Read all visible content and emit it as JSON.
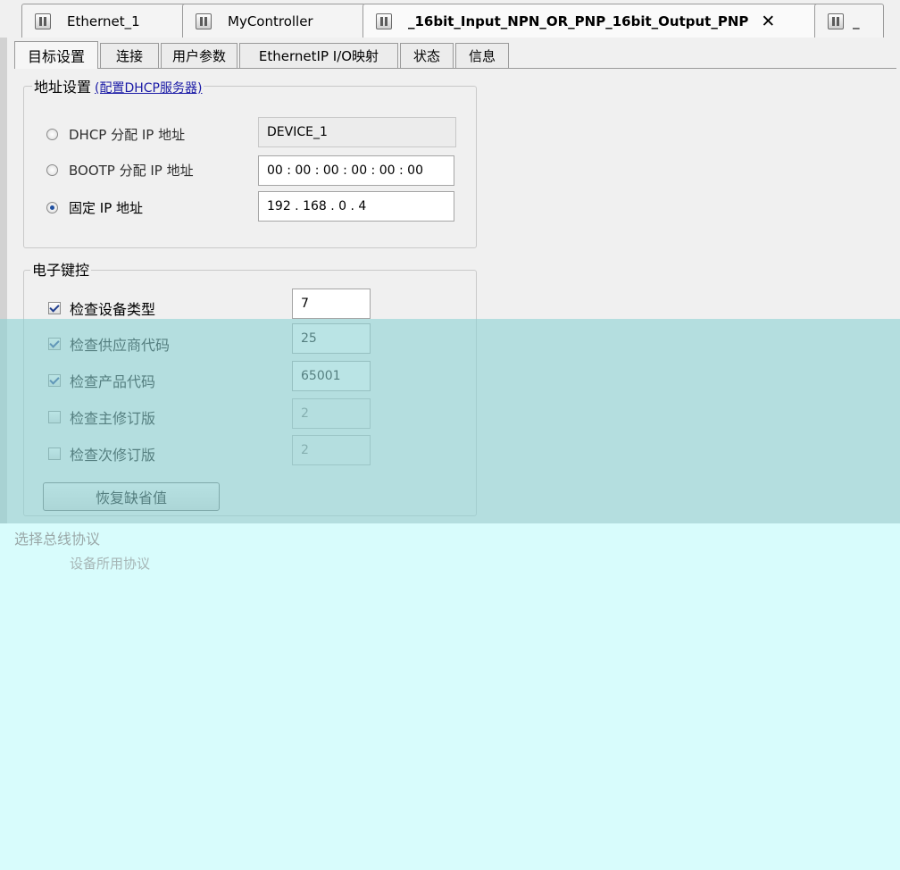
{
  "doc_tabs": [
    {
      "label": "Ethernet_1"
    },
    {
      "label": "MyController"
    },
    {
      "label": "_16bit_Input_NPN_OR_PNP_16bit_Output_PNP",
      "close": "✕"
    },
    {
      "label": "_"
    }
  ],
  "page_tabs": [
    "目标设置",
    "连接",
    "用户参数",
    "EthernetIP I/O映射",
    "状态",
    "信息"
  ],
  "address_group": {
    "title": "地址设置",
    "link": "(配置DHCP服务器)",
    "options": [
      {
        "label": "DHCP 分配 IP 地址",
        "value": "DEVICE_1",
        "selected": false
      },
      {
        "label": "BOOTP 分配 IP 地址",
        "value": "00 : 00 : 00 : 00 : 00 : 00",
        "selected": false
      },
      {
        "label": "固定 IP 地址",
        "value": "192  .  168  .   0   .   4",
        "selected": true
      }
    ]
  },
  "keying_group": {
    "title": "电子键控",
    "checks": [
      {
        "label": "检查设备类型",
        "value": "7",
        "checked": true
      },
      {
        "label": "检查供应商代码",
        "value": "25",
        "checked": true
      },
      {
        "label": "检查产品代码",
        "value": "65001",
        "checked": true
      },
      {
        "label": "检查主修订版",
        "value": "2",
        "checked": false
      },
      {
        "label": "检查次修订版",
        "value": "2",
        "checked": false
      }
    ],
    "reset_button": "恢复缺省值"
  },
  "protocol_group": {
    "title": "选择总线协议",
    "item": "设备所用协议"
  },
  "colors": {
    "overlay_band": "#8cd2d4",
    "overlay_bottom": "#d8fcfc",
    "link": "#1a1aa6"
  },
  "icons": {
    "doc_tab": "device-module-icon",
    "close": "close-icon"
  }
}
